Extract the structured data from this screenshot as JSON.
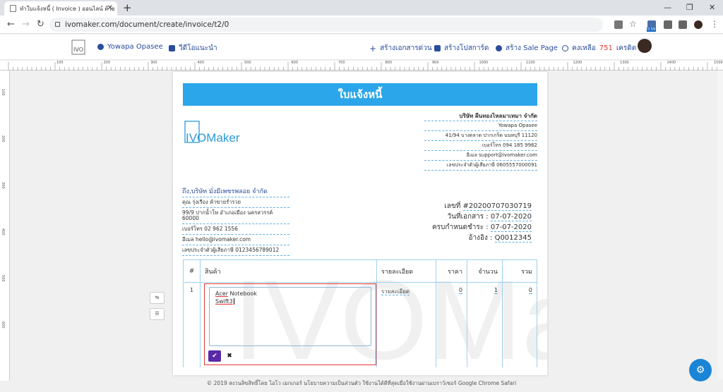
{
  "browser": {
    "tab_title": "ทำใบแจ้งหนี้ ( Invoice ) ออนไลน์ ด้วย",
    "url": "ivomaker.com/document/create/invoice/t2/0",
    "ext_badge": "0.59"
  },
  "header": {
    "logo_text": "IVO",
    "user_name": "Yowapa Opasee",
    "video_label": "วีดีโอแนะนำ",
    "quick_doc": "สร้างเอกสารด่วน",
    "poster": "สร้างโปสการ์ด",
    "sale_page": "สร้าง Sale Page",
    "credit_prefix": "คงเหลือ",
    "credit_value": "751",
    "credit_suffix": "เครดิต"
  },
  "ruler": {
    "labels": [
      "100",
      "200",
      "300",
      "400",
      "500",
      "600",
      "700",
      "800",
      "900",
      "1000",
      "1100",
      "1200",
      "1300",
      "1400",
      "1500"
    ],
    "vlabels": [
      "100",
      "200",
      "300",
      "400",
      "500",
      "600"
    ]
  },
  "document": {
    "title": "ใบแจ้งหนี้",
    "brand": "IVOMaker",
    "company": {
      "name": "บริษัท ผืนทองไหลมาเทมา จำกัด",
      "contact": "Yowapa Opasee",
      "address": "41/94 บางตลาด ปากเกร็ด นนทบุรี 11120",
      "phone": "เบอร์โทร 094 185 9962",
      "email": "อีเมล support@ivomaker.com",
      "tax": "เลขประจำตัวผู้เสียภาษี 0605557000091"
    },
    "bill_to": {
      "name": "ถึง,บริษัท มั่งมีเพชรพลอย จำกัด",
      "contact": "คุณ รุ่งเรือง ค้าขายร่ำรวย",
      "address": "99/9 ปากน้ำโพ อำเภอเมือง นครสวรรค์ 60000",
      "phone": "เบอร์โทร 02 962 1556",
      "email": "อีเมล hello@ivomaker.com",
      "tax": "เลขประจำตัวผู้เสียภาษี 0123456789012"
    },
    "doc_info": {
      "number_label": "เลขที่",
      "number": "#20200707030719",
      "date_label": "วันที่เอกสาร :",
      "date": "07-07-2020",
      "due_label": "ครบกำหนดชำระ :",
      "due": "07-07-2020",
      "ref_label": "อ้างอิง :",
      "ref": "Q0012345"
    },
    "table": {
      "headers": [
        "#",
        "สินค้า",
        "รายละเอียด",
        "ราคา",
        "จำนวน",
        "รวม"
      ],
      "row": {
        "num": "1",
        "detail": "รายละเอียด",
        "price": "0",
        "qty": "1",
        "total": "0"
      },
      "editor_line1_a": "Acer",
      "editor_line1_b": " Notebook",
      "editor_line2": "Swift3"
    }
  },
  "footer": "© 2019 สงวนลิขสิทธิ์โดย ไอโว เมกเกอร์ นโยบายความเป็นส่วนตัว ใช้งานได้ดีที่สุดเมื่อใช้งานผ่านเบราว์เซอร์ Google Chrome Safari"
}
